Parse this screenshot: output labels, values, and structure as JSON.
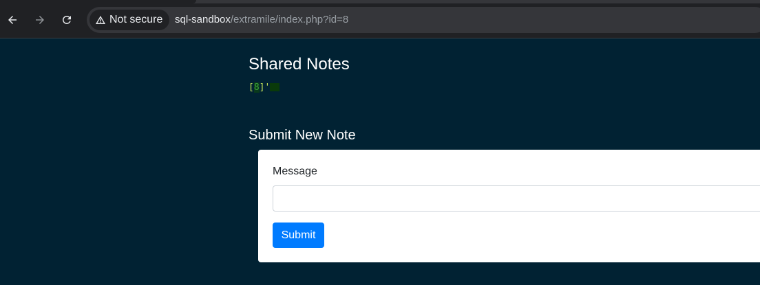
{
  "browser": {
    "security_label": "Not secure",
    "url_host": "sql-sandbox",
    "url_path": "/extramile/index.php?id=8"
  },
  "page": {
    "title": "Shared Notes",
    "note": {
      "id_open": "[",
      "id": "8",
      "id_close": "]",
      "text": "'"
    },
    "submit_section": {
      "title": "Submit New Note",
      "message_label": "Message",
      "message_value": "",
      "submit_label": "Submit"
    }
  }
}
